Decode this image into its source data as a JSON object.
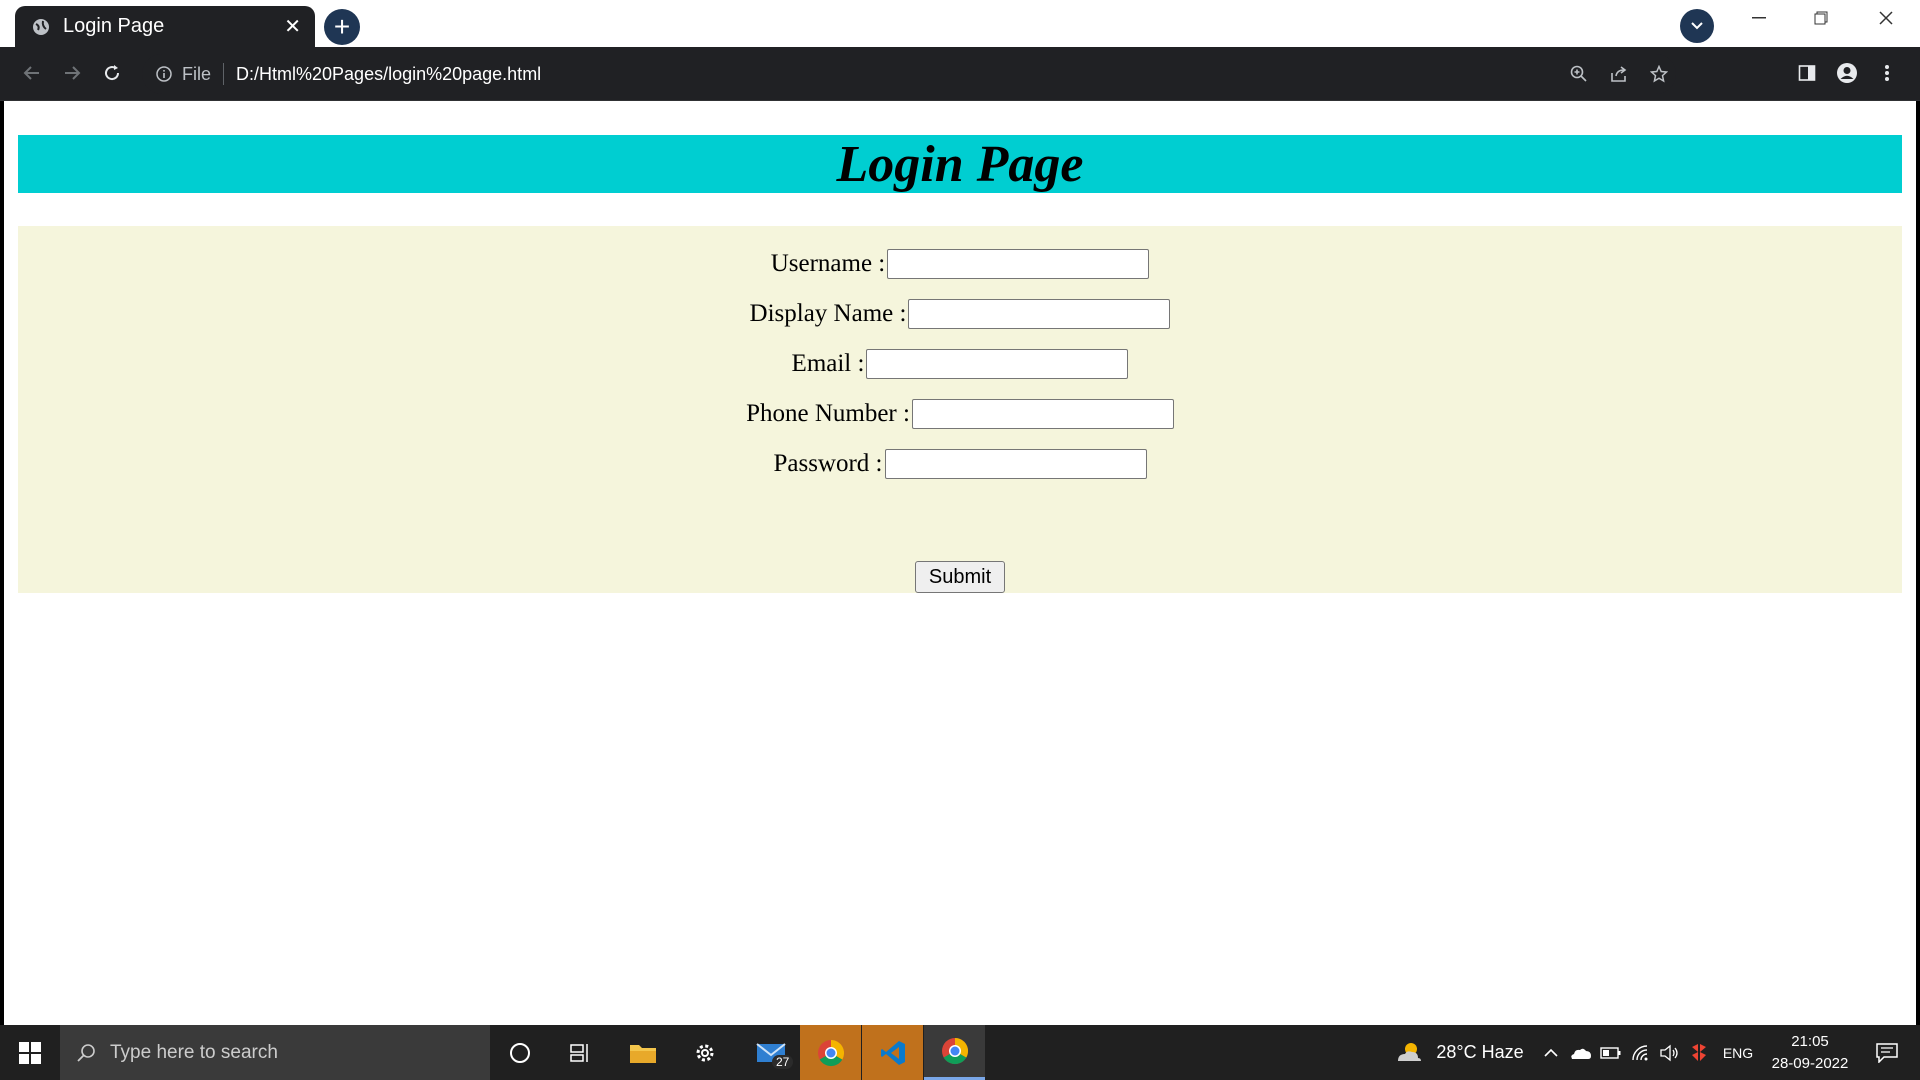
{
  "browser": {
    "tab_title": "Login Page",
    "tab_close": "✕",
    "new_tab": "+",
    "address": {
      "scheme_label": "File",
      "url": "D:/Html%20Pages/login%20page.html"
    }
  },
  "page": {
    "heading": "Login Page",
    "form": {
      "fields": [
        {
          "label": "Username :",
          "value": ""
        },
        {
          "label": "Display Name :",
          "value": ""
        },
        {
          "label": "Email :",
          "value": ""
        },
        {
          "label": "Phone Number :",
          "value": ""
        },
        {
          "label": "Password :",
          "value": ""
        }
      ],
      "submit_label": "Submit"
    },
    "colors": {
      "heading_bg": "#00ced1",
      "form_bg": "#f5f5dc"
    }
  },
  "taskbar": {
    "search_placeholder": "Type here to search",
    "mail_badge": "27",
    "weather": "28°C  Haze",
    "language": "ENG",
    "time": "21:05",
    "date": "28-09-2022"
  }
}
